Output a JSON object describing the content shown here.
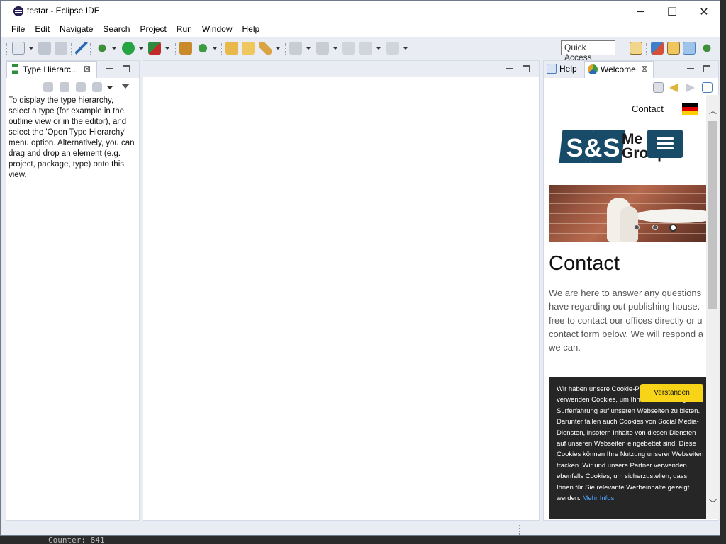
{
  "window": {
    "title": "testar - Eclipse IDE"
  },
  "window_controls": {
    "minimize": "─",
    "maximize": "☐",
    "close": "✕"
  },
  "menu": [
    "File",
    "Edit",
    "Navigate",
    "Search",
    "Project",
    "Run",
    "Window",
    "Help"
  ],
  "toolbar": {
    "quick_access_placeholder": "Quick Access"
  },
  "background": {
    "console_text": "Counter: 841"
  },
  "type_hierarchy": {
    "tab_label": "Type Hierarc...",
    "close_glyph": "⊠",
    "message": "To display the type hierarchy, select a type (for example in the outline view or in the editor), and select the 'Open Type Hierarchy' menu option. Alternatively, you can drag and drop an element (e.g. project, package, type) onto this view."
  },
  "right_panel": {
    "tabs": [
      {
        "label": "Help",
        "active": false
      },
      {
        "label": "Welcome",
        "active": true
      }
    ],
    "close_glyph": "⊠"
  },
  "web": {
    "nav_contact": "Contact",
    "logo_mark": "S&S",
    "logo_text_line1": "Me",
    "logo_text_line2": "Group",
    "heading": "Contact",
    "paragraph_lines": [
      "We are here to answer any questions",
      "have regarding out publishing house.",
      "free to contact our offices directly or u",
      "contact form below. We will respond a",
      "we can."
    ],
    "slider": {
      "dot_count": 3,
      "active_dot": 3
    },
    "cookie": {
      "text": "Wir haben unsere Cookie-Policy geändert. Wir verwenden Cookies, um Ihnen die bestmögliche Surferfahrung auf unseren Webseiten zu bieten. Darunter fallen auch Cookies von Social Media-Diensten, insofern Inhalte von diesen Diensten auf unseren Webseiten eingebettet sind. Diese Cookies können Ihre Nutzung unserer Webseiten tracken. Wir und unsere Partner verwenden ebenfalls Cookies, um sicherzustellen, dass Ihnen für Sie relevante Werbeinhalte gezeigt werden.",
      "more_link": "Mehr Infos",
      "accept_button": "Verstanden"
    },
    "colors": {
      "brand": "#174b68",
      "cookie_bg": "#262626",
      "cookie_button": "#f7d417",
      "link": "#4aa3ff"
    }
  }
}
